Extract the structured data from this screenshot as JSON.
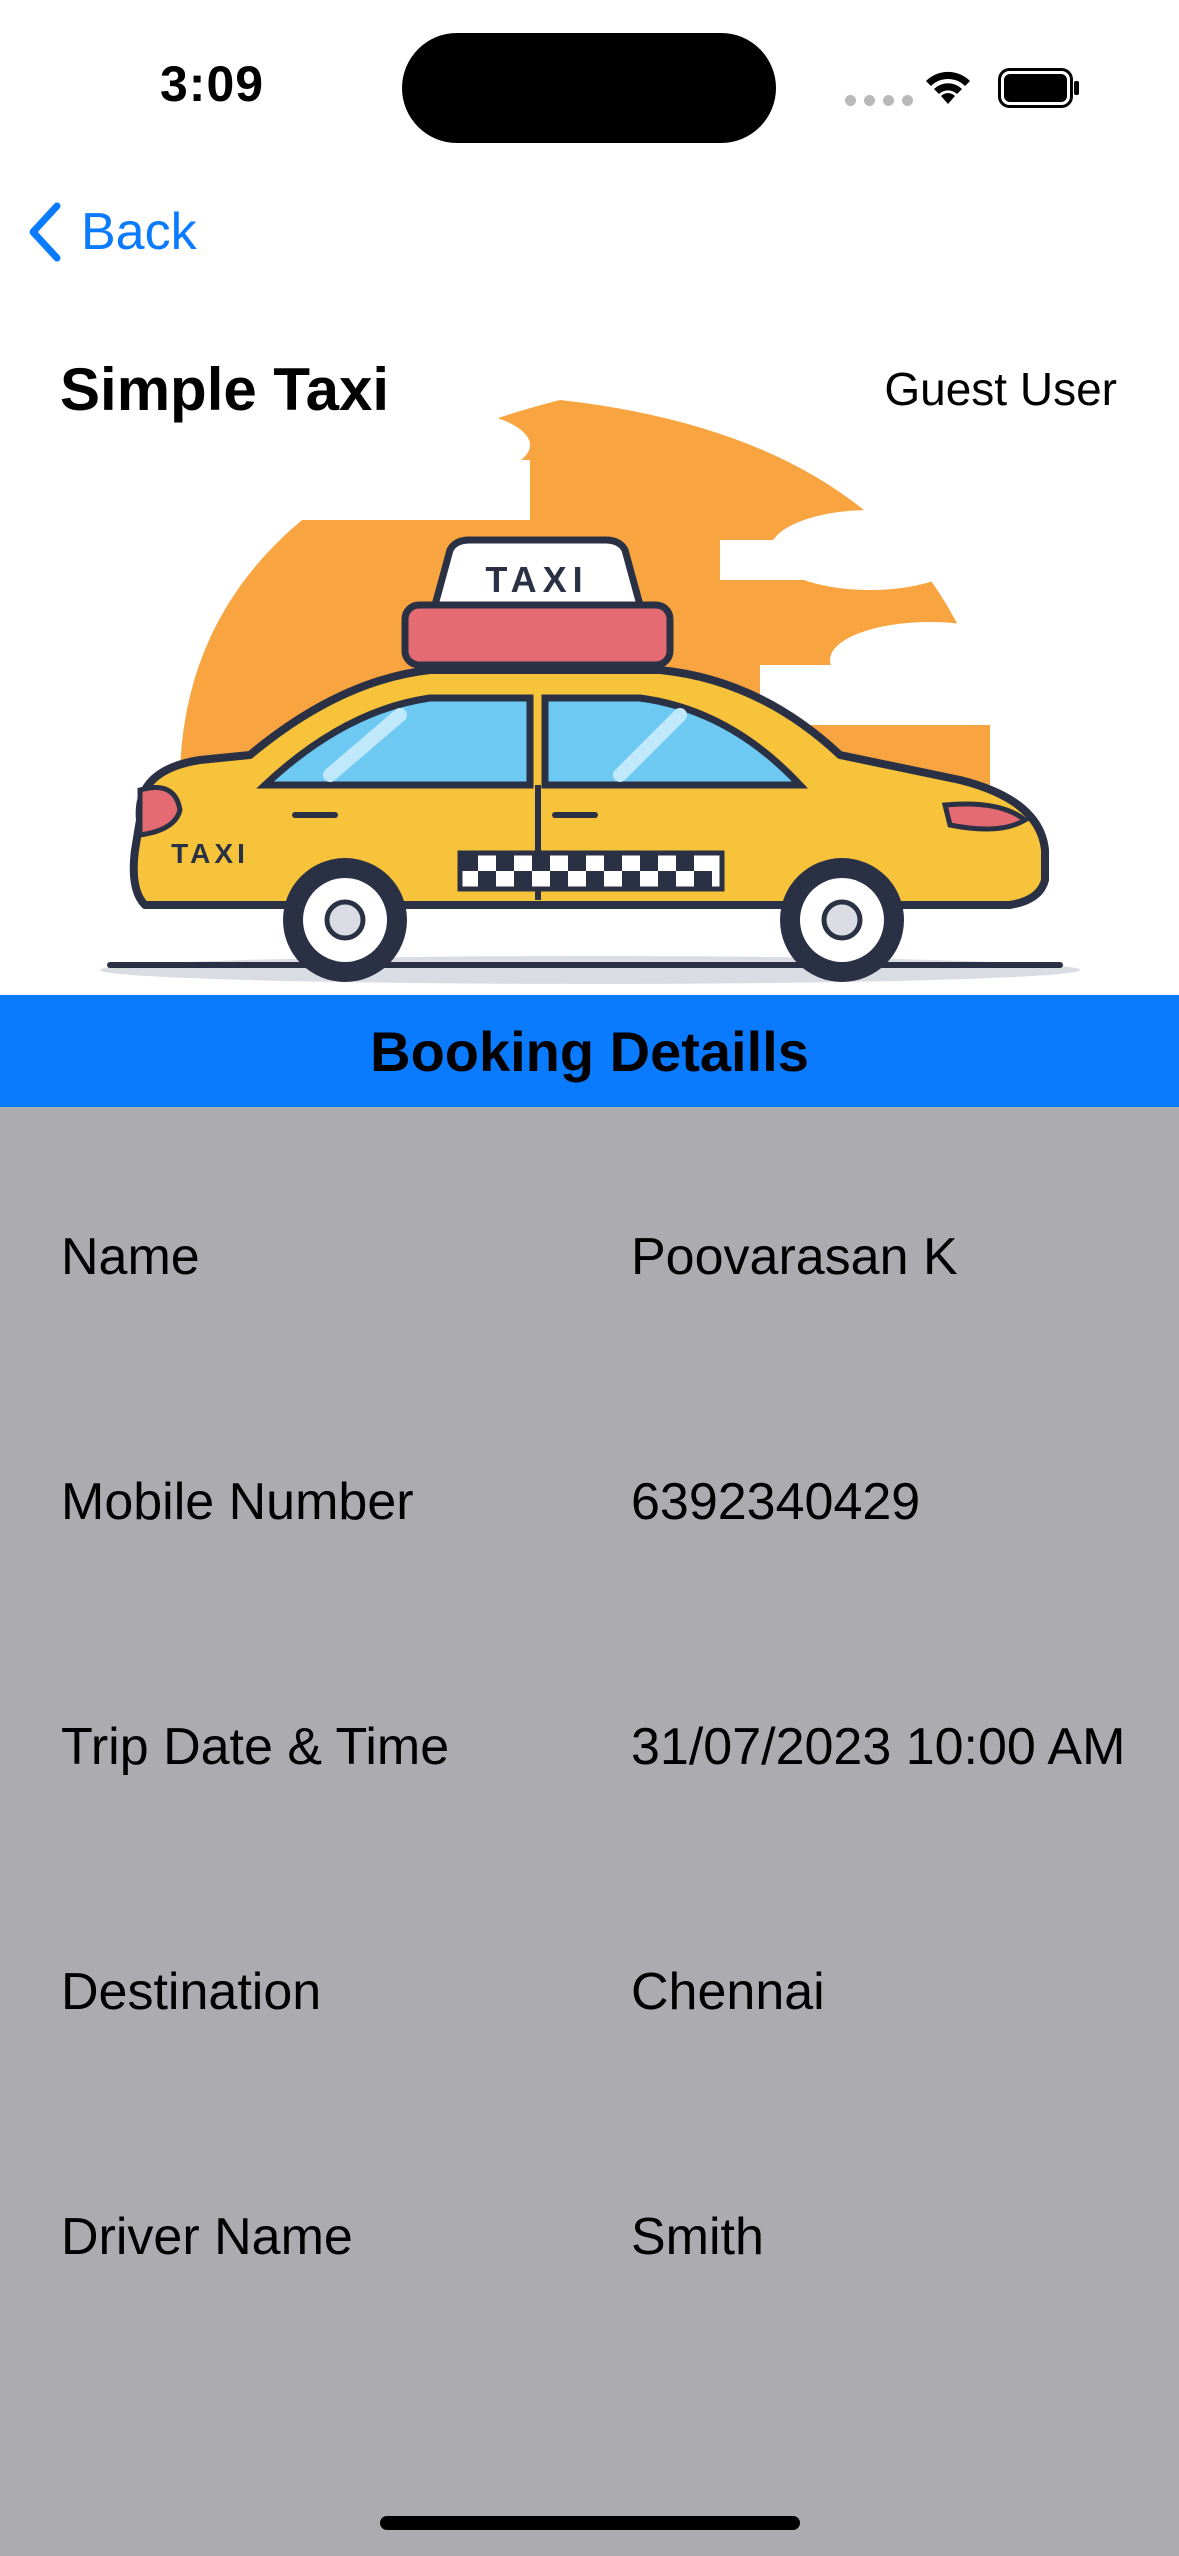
{
  "status_bar": {
    "time": "3:09"
  },
  "nav": {
    "back_label": "Back"
  },
  "header": {
    "title": "Simple Taxi",
    "user": "Guest User"
  },
  "hero": {
    "roof_sign_text": "TAXI",
    "side_text": "TAXI"
  },
  "section": {
    "title": "Booking Detaills"
  },
  "details": [
    {
      "label": "Name",
      "value": "Poovarasan K"
    },
    {
      "label": "Mobile Number",
      "value": "6392340429"
    },
    {
      "label": "Trip Date & Time",
      "value": "31/07/2023 10:00 AM"
    },
    {
      "label": "Destination",
      "value": "Chennai"
    },
    {
      "label": "Driver Name",
      "value": "Smith"
    }
  ],
  "colors": {
    "accent": "#0a7aff",
    "details_background": "#acabb0",
    "taxi_yellow": "#f6c33a",
    "sun_orange": "#f8a541"
  }
}
